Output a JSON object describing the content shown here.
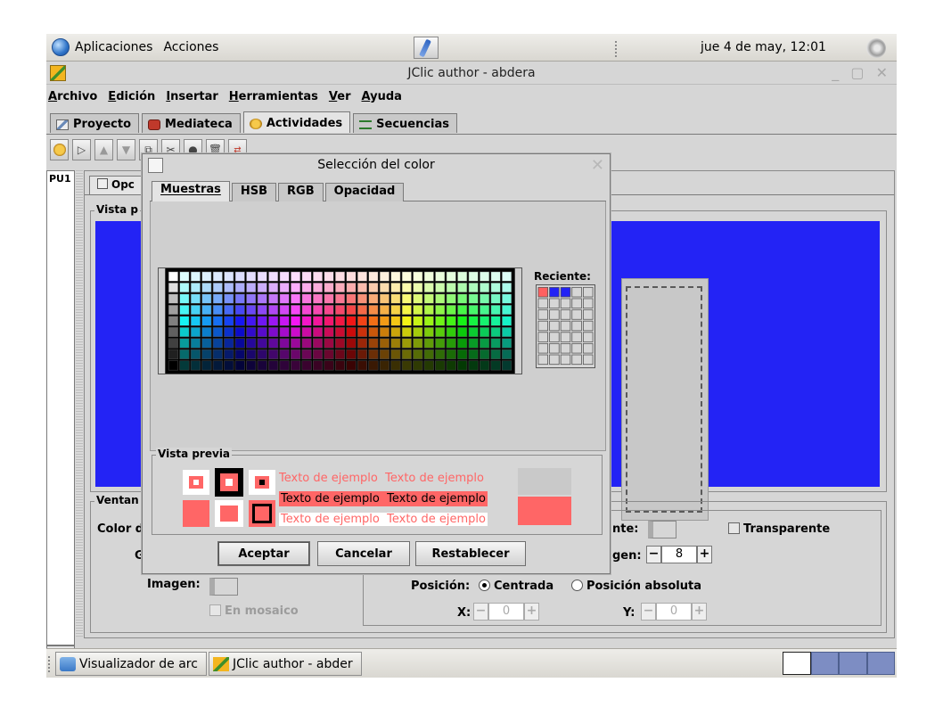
{
  "panel": {
    "apps_menu": "Aplicaciones",
    "actions_menu": "Acciones",
    "clock": "jue  4 de may, 12:01"
  },
  "window": {
    "title": "JClic author - abdera",
    "controls": "_ ▢ ✕"
  },
  "menubar": [
    "Archivo",
    "Edición",
    "Insertar",
    "Herramientas",
    "Ver",
    "Ayuda"
  ],
  "main_tabs": [
    "Proyecto",
    "Mediateca",
    "Actividades",
    "Secuencias"
  ],
  "left_list": {
    "item": "PU1"
  },
  "activity": {
    "tab_label": "Opc",
    "preview_group": "Vista p",
    "window_group": "Ventan",
    "color_label": "Color d",
    "g_label": "G",
    "image_label": "Imagen:",
    "tile_label": "En mosaico",
    "border_label": "nte:",
    "transparent_label": "Transparente",
    "margin_label": "gen:",
    "margin_value": "8",
    "position_label": "Posición:",
    "centered_label": "Centrada",
    "absolute_label": "Posición absoluta",
    "x_label": "X:",
    "x_value": "0",
    "y_label": "Y:",
    "y_value": "0"
  },
  "dialog": {
    "title": "Selección del color",
    "tabs": [
      "Muestras",
      "HSB",
      "RGB",
      "Opacidad"
    ],
    "recent_label": "Reciente:",
    "recent_colors": [
      "#ff6060",
      "#2323f5",
      "#2323f5"
    ],
    "preview_label": "Vista previa",
    "sample_text": "Texto de ejemplo",
    "selected_color": "#ff6666",
    "buttons": {
      "accept": "Aceptar",
      "cancel": "Cancelar",
      "reset": "Restablecer"
    }
  },
  "taskbar": {
    "task1": "Visualizador de arc",
    "task2": "JClic author - abder"
  },
  "colors": {
    "preview_blue": "#2323f5",
    "selected": "#ff6666"
  }
}
